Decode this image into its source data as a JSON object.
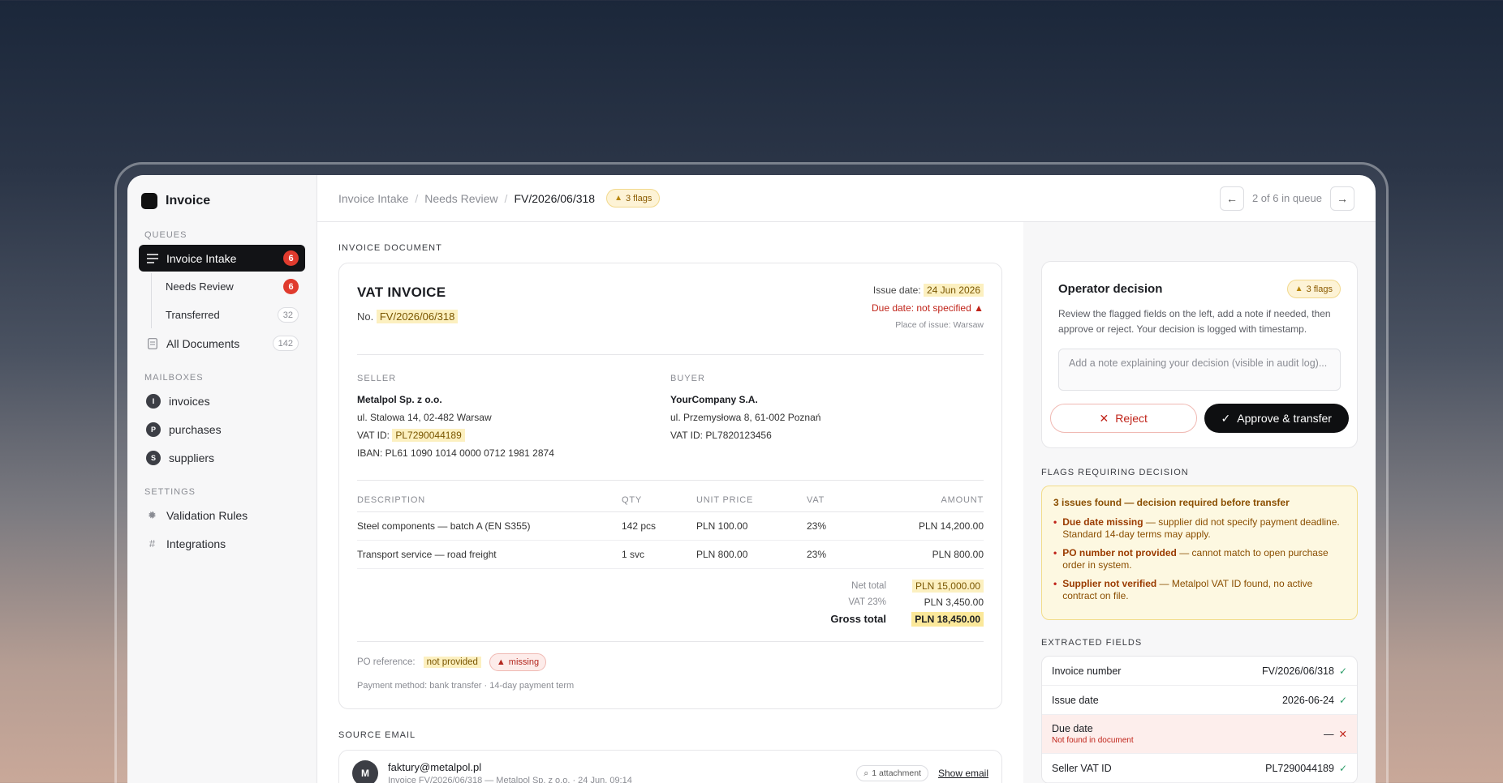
{
  "app": {
    "name": "Invoice"
  },
  "sidebar": {
    "queues_title": "QUEUES",
    "intake": {
      "label": "Invoice Intake",
      "count": "6"
    },
    "needs_review": {
      "label": "Needs Review",
      "count": "6"
    },
    "transferred": {
      "label": "Transferred",
      "count": "32"
    },
    "all_docs": {
      "label": "All Documents",
      "count": "142"
    },
    "mailboxes_title": "MAILBOXES",
    "mailboxes": [
      {
        "initial": "I",
        "label": "invoices"
      },
      {
        "initial": "P",
        "label": "purchases"
      },
      {
        "initial": "S",
        "label": "suppliers"
      }
    ],
    "settings_title": "SETTINGS",
    "settings": [
      {
        "label": "Validation Rules"
      },
      {
        "label": "Integrations"
      }
    ]
  },
  "topbar": {
    "crumb1": "Invoice Intake",
    "crumb2": "Needs Review",
    "crumb3": "FV/2026/06/318",
    "flags": "3 flags",
    "queue_pos": "2 of 6 in queue"
  },
  "doc": {
    "section_label": "INVOICE DOCUMENT",
    "title": "VAT INVOICE",
    "no_label": "No.",
    "no_value": "FV/2026/06/318",
    "issue_label": "Issue date:",
    "issue_value": "24 Jun 2026",
    "due_label": "Due date:",
    "due_value": "not specified",
    "place": "Place of issue: Warsaw",
    "seller": {
      "caps": "SELLER",
      "name": "Metalpol Sp. z o.o.",
      "address": "ul. Stalowa 14, 02-482 Warsaw",
      "vat_label": "VAT ID:",
      "vat_value": "PL7290044189",
      "iban": "IBAN: PL61 1090 1014 0000 0712 1981 2874"
    },
    "buyer": {
      "caps": "BUYER",
      "name": "YourCompany S.A.",
      "address": "ul. Przemysłowa 8, 61-002 Poznań",
      "vat": "VAT ID: PL7820123456"
    },
    "columns": {
      "desc": "DESCRIPTION",
      "qty": "QTY",
      "price": "UNIT PRICE",
      "vat": "VAT",
      "amount": "AMOUNT"
    },
    "items": [
      {
        "desc": "Steel components — batch A (EN S355)",
        "qty": "142 pcs",
        "price": "PLN 100.00",
        "vat": "23%",
        "amount": "PLN 14,200.00"
      },
      {
        "desc": "Transport service — road freight",
        "qty": "1 svc",
        "price": "PLN 800.00",
        "vat": "23%",
        "amount": "PLN 800.00"
      }
    ],
    "net_label": "Net total",
    "net_value": "PLN 15,000.00",
    "vat_label": "VAT 23%",
    "vat_value": "PLN 3,450.00",
    "gross_label": "Gross total",
    "gross_value": "PLN 18,450.00",
    "po_label": "PO reference:",
    "po_value": "not provided",
    "po_missing": "missing",
    "payment": "Payment method: bank transfer · 14-day payment term"
  },
  "email": {
    "section_label": "SOURCE EMAIL",
    "initial": "M",
    "from": "faktury@metalpol.pl",
    "subject": "Invoice FV/2026/06/318 — Metalpol Sp. z o.o. · 24 Jun, 09:14",
    "attachment": "1 attachment",
    "show": "Show email"
  },
  "decision": {
    "title": "Operator decision",
    "flags": "3 flags",
    "desc": "Review the flagged fields on the left, add a note if needed, then approve or reject. Your decision is logged with timestamp.",
    "placeholder": "Add a note explaining your decision (visible in audit log)...",
    "reject": "Reject",
    "approve": "Approve & transfer"
  },
  "flags_section": {
    "label": "FLAGS REQUIRING DECISION",
    "head": "3 issues found — decision required before transfer",
    "items": [
      {
        "title": "Due date missing",
        "text": " — supplier did not specify payment deadline. Standard 14-day terms may apply."
      },
      {
        "title": "PO number not provided",
        "text": " — cannot match to open purchase order in system."
      },
      {
        "title": "Supplier not verified",
        "text": " — Metalpol VAT ID found, no active contract on file."
      }
    ]
  },
  "fields_section": {
    "label": "EXTRACTED FIELDS",
    "rows": [
      {
        "label": "Invoice number",
        "value": "FV/2026/06/318"
      },
      {
        "label": "Issue date",
        "value": "2026-06-24"
      },
      {
        "label": "Due date",
        "sub": "Not found in document",
        "value": "—"
      },
      {
        "label": "Seller VAT ID",
        "value": "PL7290044189"
      }
    ]
  },
  "colors": {
    "accent": "#121316",
    "danger": "#e03b2e",
    "warning_bg": "#fdf8e1",
    "success": "#2f9e6b"
  }
}
